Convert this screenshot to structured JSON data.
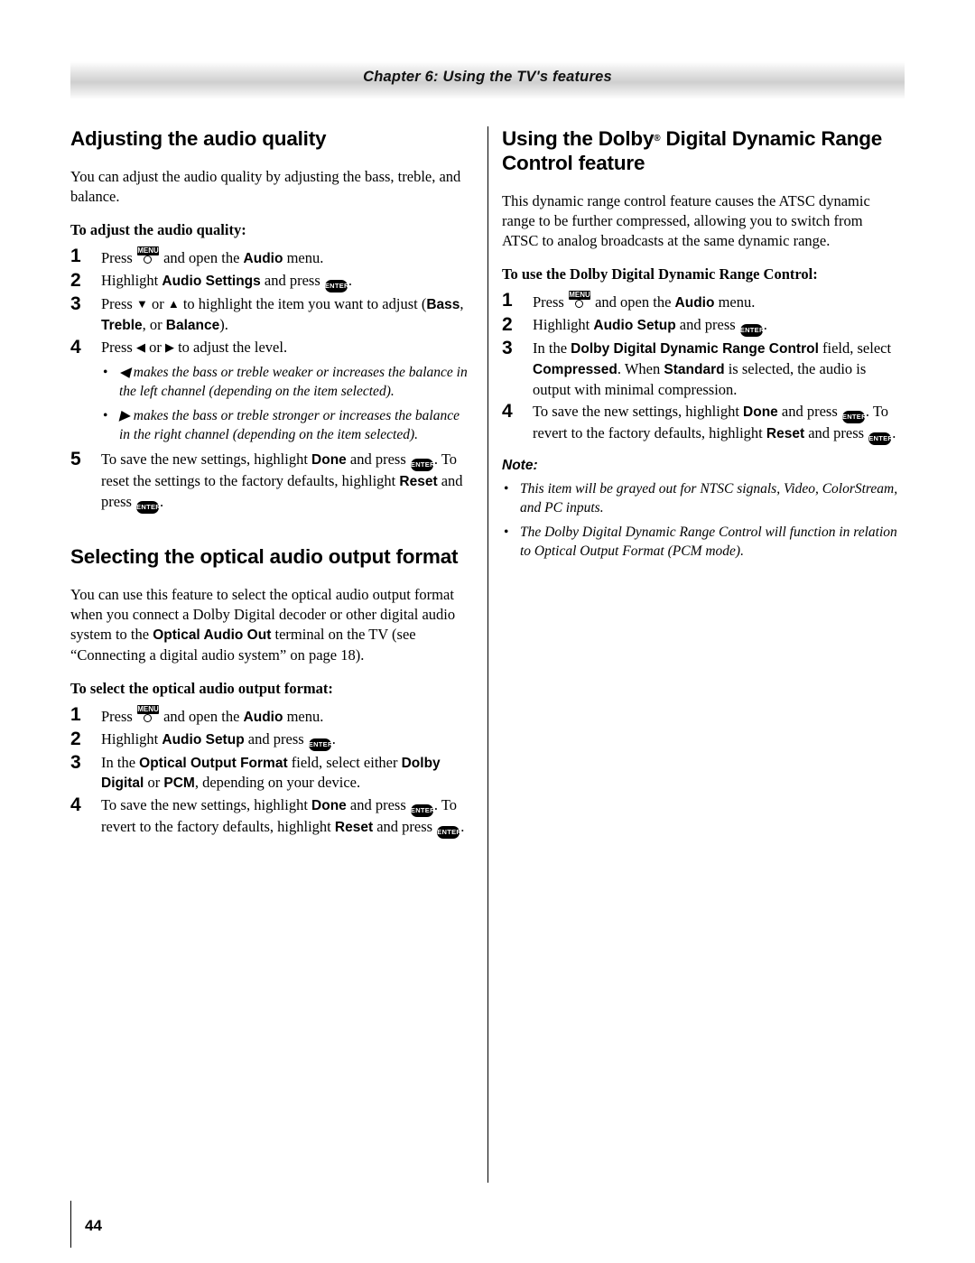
{
  "header": {
    "chapter_title": "Chapter 6: Using the TV's features"
  },
  "footer": {
    "page_number": "44"
  },
  "left_column": {
    "section1": {
      "title": "Adjusting the audio quality",
      "intro": "You can adjust the audio quality by adjusting the bass, treble, and balance.",
      "subhead": "To adjust the audio quality:",
      "steps": [
        {
          "num": "1",
          "parts": [
            {
              "t": "text",
              "v": "Press "
            },
            {
              "t": "key",
              "v": "MENU"
            },
            {
              "t": "text",
              "v": " and open the "
            },
            {
              "t": "bold",
              "v": "Audio"
            },
            {
              "t": "text",
              "v": " menu."
            }
          ]
        },
        {
          "num": "2",
          "parts": [
            {
              "t": "text",
              "v": "Highlight "
            },
            {
              "t": "bold",
              "v": "Audio Settings"
            },
            {
              "t": "text",
              "v": " and press "
            },
            {
              "t": "key",
              "v": "ENTER"
            },
            {
              "t": "text",
              "v": "."
            }
          ]
        },
        {
          "num": "3",
          "parts": [
            {
              "t": "text",
              "v": "Press "
            },
            {
              "t": "glyph",
              "v": "▼"
            },
            {
              "t": "text",
              "v": " or "
            },
            {
              "t": "glyph",
              "v": "▲"
            },
            {
              "t": "text",
              "v": " to highlight the item you want to adjust ("
            },
            {
              "t": "bold",
              "v": "Bass"
            },
            {
              "t": "text",
              "v": ", "
            },
            {
              "t": "bold",
              "v": "Treble"
            },
            {
              "t": "text",
              "v": ", or "
            },
            {
              "t": "bold",
              "v": "Balance"
            },
            {
              "t": "text",
              "v": ")."
            }
          ]
        },
        {
          "num": "4",
          "parts": [
            {
              "t": "text",
              "v": "Press "
            },
            {
              "t": "glyph",
              "v": "◀"
            },
            {
              "t": "text",
              "v": " or "
            },
            {
              "t": "glyph",
              "v": "▶"
            },
            {
              "t": "text",
              "v": " to adjust the level."
            }
          ]
        }
      ],
      "bullets": [
        "◀ makes the bass or treble weaker or increases the balance in the left channel (depending on the item selected).",
        "▶ makes the bass or treble stronger or increases the balance in the right channel (depending on the item selected)."
      ],
      "step5": {
        "num": "5",
        "parts": [
          {
            "t": "text",
            "v": "To save the new settings, highlight "
          },
          {
            "t": "bold",
            "v": "Done"
          },
          {
            "t": "text",
            "v": " and press "
          },
          {
            "t": "key",
            "v": "ENTER"
          },
          {
            "t": "text",
            "v": ". To reset the settings to the factory defaults, highlight "
          },
          {
            "t": "bold",
            "v": "Reset"
          },
          {
            "t": "text",
            "v": " and press "
          },
          {
            "t": "key",
            "v": "ENTER"
          },
          {
            "t": "text",
            "v": "."
          }
        ]
      }
    },
    "section2": {
      "title": "Selecting the optical audio output format",
      "intro_parts": [
        {
          "t": "text",
          "v": "You can use this feature to select the optical audio output format when you connect a Dolby Digital decoder or other digital audio system to the "
        },
        {
          "t": "bold",
          "v": "Optical Audio Out"
        },
        {
          "t": "text",
          "v": " terminal on the TV (see “Connecting a digital audio system” on page 18)."
        }
      ],
      "subhead": "To select the optical audio output format:",
      "steps": [
        {
          "num": "1",
          "parts": [
            {
              "t": "text",
              "v": "Press "
            },
            {
              "t": "key",
              "v": "MENU"
            },
            {
              "t": "text",
              "v": " and open the "
            },
            {
              "t": "bold",
              "v": "Audio"
            },
            {
              "t": "text",
              "v": " menu."
            }
          ]
        },
        {
          "num": "2",
          "parts": [
            {
              "t": "text",
              "v": "Highlight "
            },
            {
              "t": "bold",
              "v": "Audio Setup"
            },
            {
              "t": "text",
              "v": " and press "
            },
            {
              "t": "key",
              "v": "ENTER"
            },
            {
              "t": "text",
              "v": "."
            }
          ]
        },
        {
          "num": "3",
          "parts": [
            {
              "t": "text",
              "v": "In the "
            },
            {
              "t": "bold",
              "v": "Optical Output Format"
            },
            {
              "t": "text",
              "v": " field, select either "
            },
            {
              "t": "bold",
              "v": "Dolby Digital"
            },
            {
              "t": "text",
              "v": " or "
            },
            {
              "t": "bold",
              "v": "PCM"
            },
            {
              "t": "text",
              "v": ", depending on your device."
            }
          ]
        },
        {
          "num": "4",
          "parts": [
            {
              "t": "text",
              "v": "To save the new settings, highlight "
            },
            {
              "t": "bold",
              "v": "Done"
            },
            {
              "t": "text",
              "v": " and press "
            },
            {
              "t": "key",
              "v": "ENTER"
            },
            {
              "t": "text",
              "v": ". To revert to the factory defaults, highlight "
            },
            {
              "t": "bold",
              "v": "Reset"
            },
            {
              "t": "text",
              "v": " and press "
            },
            {
              "t": "key",
              "v": "ENTER"
            },
            {
              "t": "text",
              "v": "."
            }
          ]
        }
      ]
    }
  },
  "right_column": {
    "section1": {
      "title_parts": [
        {
          "t": "text",
          "v": "Using the Dolby"
        },
        {
          "t": "sup",
          "v": "®"
        },
        {
          "t": "text",
          "v": " Digital Dynamic Range Control feature"
        }
      ],
      "intro": "This dynamic range control feature causes the ATSC dynamic range to be further compressed, allowing you to switch from ATSC to analog broadcasts at the same dynamic range.",
      "subhead": "To use the Dolby Digital Dynamic Range Control:",
      "steps": [
        {
          "num": "1",
          "parts": [
            {
              "t": "text",
              "v": "Press "
            },
            {
              "t": "key",
              "v": "MENU"
            },
            {
              "t": "text",
              "v": " and open the "
            },
            {
              "t": "bold",
              "v": "Audio"
            },
            {
              "t": "text",
              "v": " menu."
            }
          ]
        },
        {
          "num": "2",
          "parts": [
            {
              "t": "text",
              "v": "Highlight "
            },
            {
              "t": "bold",
              "v": "Audio Setup"
            },
            {
              "t": "text",
              "v": " and press "
            },
            {
              "t": "key",
              "v": "ENTER"
            },
            {
              "t": "text",
              "v": "."
            }
          ]
        },
        {
          "num": "3",
          "parts": [
            {
              "t": "text",
              "v": "In the "
            },
            {
              "t": "bold",
              "v": "Dolby Digital Dynamic Range Control"
            },
            {
              "t": "text",
              "v": " field, select "
            },
            {
              "t": "bold",
              "v": "Compressed"
            },
            {
              "t": "text",
              "v": ". When "
            },
            {
              "t": "bold",
              "v": "Standard"
            },
            {
              "t": "text",
              "v": " is selected, the audio is output with minimal compression."
            }
          ]
        },
        {
          "num": "4",
          "parts": [
            {
              "t": "text",
              "v": "To save the new settings, highlight "
            },
            {
              "t": "bold",
              "v": "Done"
            },
            {
              "t": "text",
              "v": " and press "
            },
            {
              "t": "key",
              "v": "ENTER"
            },
            {
              "t": "text",
              "v": ". To revert to the factory defaults, highlight "
            },
            {
              "t": "bold",
              "v": "Reset"
            },
            {
              "t": "text",
              "v": " and press "
            },
            {
              "t": "key",
              "v": "ENTER"
            },
            {
              "t": "text",
              "v": "."
            }
          ]
        }
      ],
      "note_label": "Note:",
      "notes": [
        "This item will be grayed out for NTSC signals, Video, ColorStream, and PC inputs.",
        "The Dolby Digital Dynamic Range Control will function in relation to Optical Output Format (PCM mode)."
      ]
    }
  },
  "icons": {
    "menu_key_label": "MENU",
    "enter_key_label": "ENTER"
  }
}
